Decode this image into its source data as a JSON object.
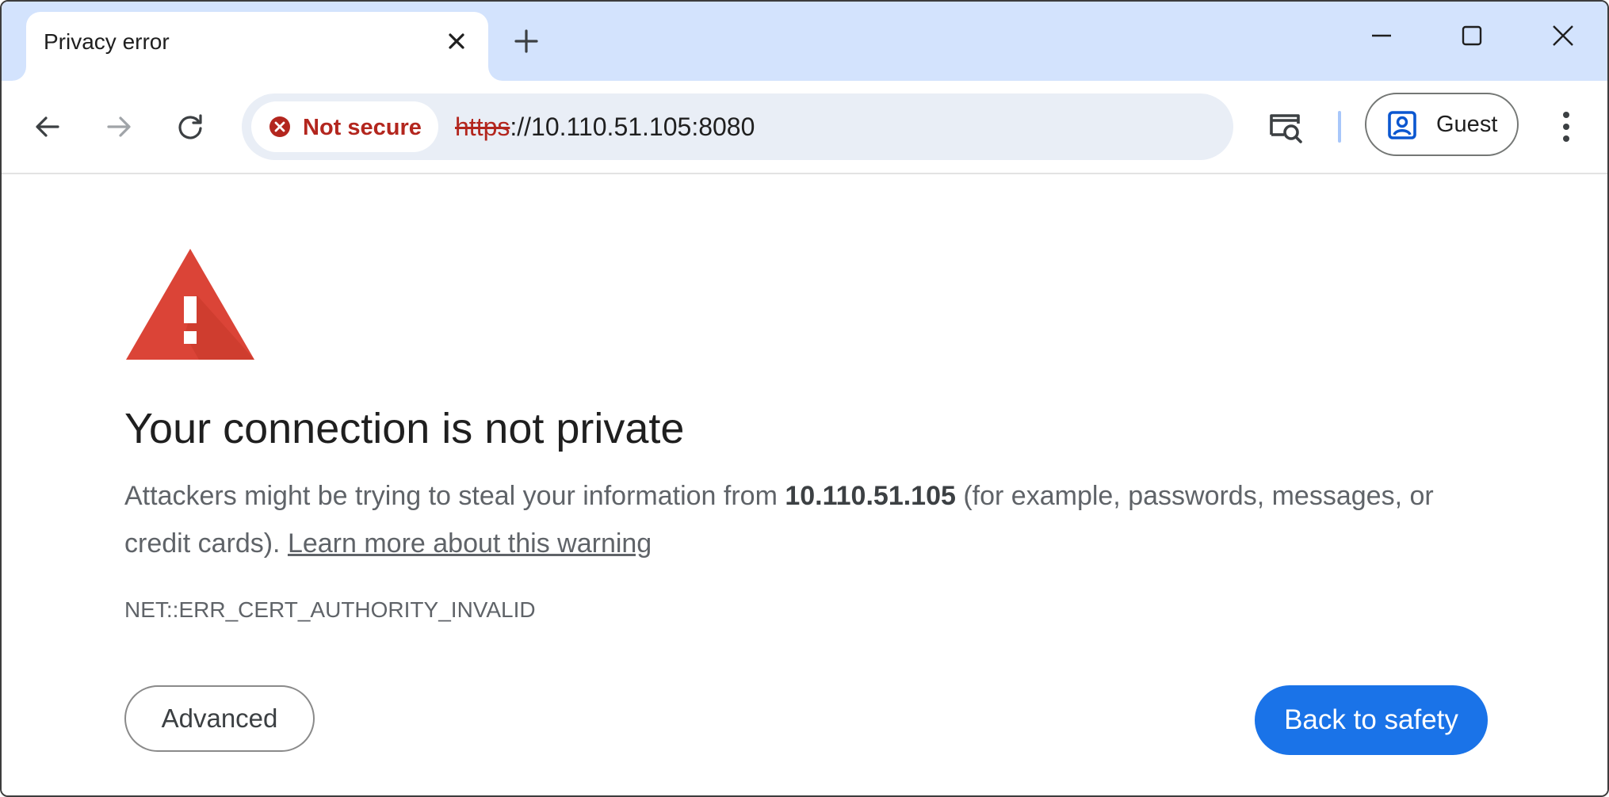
{
  "tab": {
    "title": "Privacy error"
  },
  "omnibox": {
    "security_chip": "Not secure",
    "url_scheme": "https",
    "url_rest": "://10.110.51.105:8080"
  },
  "profile": {
    "label": "Guest"
  },
  "page": {
    "headline": "Your connection is not private",
    "desc_prefix": "Attackers might be trying to steal your information from ",
    "host": "10.110.51.105",
    "desc_suffix": " (for example, passwords, messages, or credit cards). ",
    "learn_more": "Learn more about this warning",
    "error_code": "NET::ERR_CERT_AUTHORITY_INVALID",
    "advanced_label": "Advanced",
    "back_label": "Back to safety"
  },
  "colors": {
    "tabstrip_bg": "#d3e3fd",
    "warning_red": "#db4437",
    "not_secure_red": "#b3261e",
    "primary_blue": "#1a73e8",
    "omnibox_bg": "#e9eef6"
  },
  "icons": {
    "tab_close": "close-icon",
    "new_tab": "plus-icon",
    "minimize": "minimize-icon",
    "maximize": "maximize-icon",
    "close_window": "close-icon",
    "back": "arrow-left-icon",
    "forward": "arrow-right-icon",
    "reload": "reload-icon",
    "not_secure": "error-circle-icon",
    "search_tab": "tab-search-icon",
    "profile": "account-box-icon",
    "menu": "more-vertical-icon",
    "warning": "warning-triangle-icon"
  }
}
